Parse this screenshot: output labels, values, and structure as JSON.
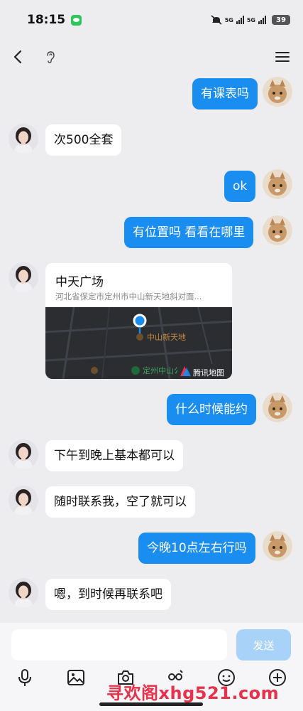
{
  "status_bar": {
    "time": "18:15",
    "net1": "5G",
    "net2": "5G",
    "battery": "39"
  },
  "messages": [
    {
      "side": "out",
      "text": "有课表吗"
    },
    {
      "side": "in",
      "text": "次500全套"
    },
    {
      "side": "out",
      "text": "ok"
    },
    {
      "side": "out",
      "text": "有位置吗 看看在哪里"
    },
    {
      "side": "out",
      "text": "什么时候能约"
    },
    {
      "side": "in",
      "text": "下午到晚上基本都可以"
    },
    {
      "side": "in",
      "text": "随时联系我，空了就可以"
    },
    {
      "side": "out",
      "text": "今晚10点左右行吗"
    },
    {
      "side": "in",
      "text": "嗯，到时候再联系吧"
    }
  ],
  "location": {
    "name": "中天广场",
    "address": "河北省保定市定州市中山新天地斜对面...",
    "map_poi_1": "中山新天地",
    "map_poi_2": "定州中山公园",
    "map_brand": "腾讯地图"
  },
  "input": {
    "value": "",
    "send_label": "发送"
  },
  "watermark": "寻欢阁xhg521.com",
  "colors": {
    "out_bubble": "#1a8df0",
    "in_bubble": "#ffffff",
    "background": "#ededf0",
    "send_disabled": "#a8d2f7",
    "watermark": "#e8314a"
  },
  "icons": [
    "back-arrow-icon",
    "ear-icon",
    "menu-icon",
    "microphone-icon",
    "image-icon",
    "camera-icon",
    "sticker-face-icon",
    "emoji-icon",
    "plus-icon"
  ]
}
